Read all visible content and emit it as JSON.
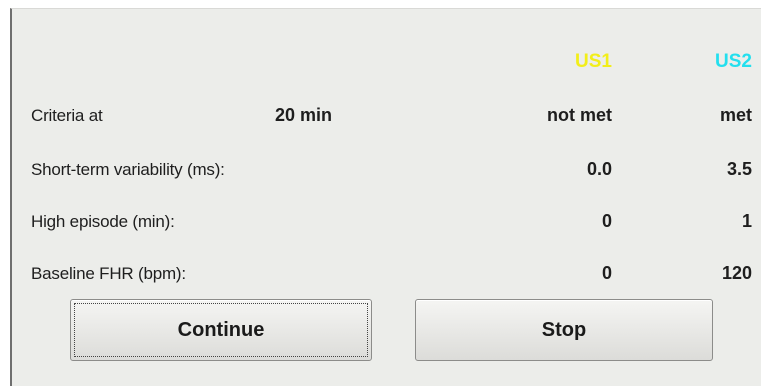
{
  "columns": {
    "us1": {
      "label": "US1",
      "color": "#f2ee1a"
    },
    "us2": {
      "label": "US2",
      "color": "#23dfee"
    }
  },
  "rows": [
    {
      "label": "Criteria at",
      "time": "20 min",
      "us1": "not met",
      "us2": "met"
    },
    {
      "label": "Short-term variability (ms):",
      "us1": "0.0",
      "us2": "3.5"
    },
    {
      "label": "High episode (min):",
      "us1": "0",
      "us2": "1"
    },
    {
      "label": "Baseline FHR (bpm):",
      "us1": "0",
      "us2": "120"
    }
  ],
  "buttons": {
    "continue": "Continue",
    "stop": "Stop"
  }
}
